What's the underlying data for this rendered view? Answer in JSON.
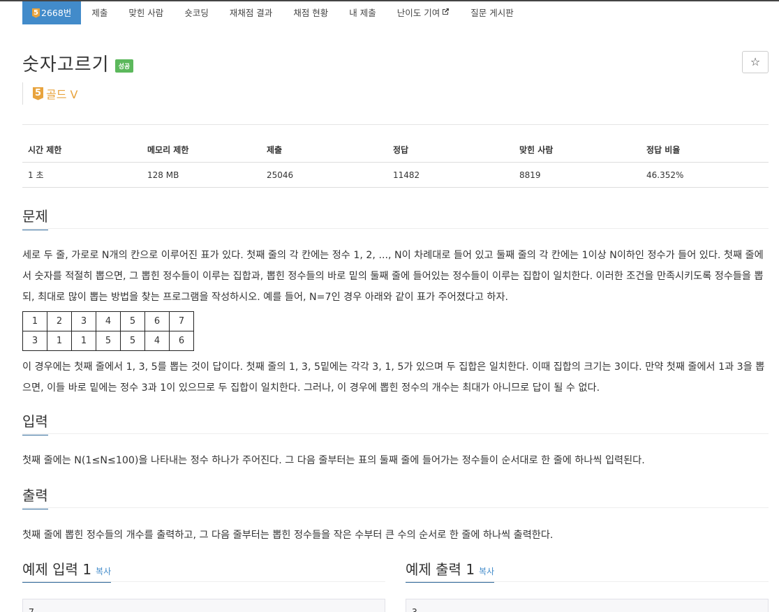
{
  "tabs": [
    {
      "label": "2668번",
      "tier": "5"
    },
    {
      "label": "제출"
    },
    {
      "label": "맞힌 사람"
    },
    {
      "label": "숏코딩"
    },
    {
      "label": "재채점 결과"
    },
    {
      "label": "채점 현황"
    },
    {
      "label": "내 제출"
    },
    {
      "label": "난이도 기여"
    },
    {
      "label": "질문 게시판"
    }
  ],
  "problem": {
    "title": "숫자고르기",
    "status_badge": "성공",
    "tier_num": "5",
    "tier_label": "골드 V",
    "star": "☆"
  },
  "info": {
    "headers": [
      "시간 제한",
      "메모리 제한",
      "제출",
      "정답",
      "맞힌 사람",
      "정답 비율"
    ],
    "values": [
      "1 초",
      "128 MB",
      "25046",
      "11482",
      "8819",
      "46.352%"
    ]
  },
  "sections": {
    "problem_head": "문제",
    "problem_p1": "세로 두 줄, 가로로 N개의 칸으로 이루어진 표가 있다. 첫째 줄의 각 칸에는 정수 1, 2, ..., N이 차례대로 들어 있고 둘째 줄의 각 칸에는 1이상 N이하인 정수가 들어 있다. 첫째 줄에서 숫자를 적절히 뽑으면, 그 뽑힌 정수들이 이루는 집합과, 뽑힌 정수들의 바로 밑의 둘째 줄에 들어있는 정수들이 이루는 집합이 일치한다. 이러한 조건을 만족시키도록 정수들을 뽑되, 최대로 많이 뽑는 방법을 찾는 프로그램을 작성하시오. 예를 들어, N=7인 경우 아래와 같이 표가 주어졌다고 하자.",
    "example_table": [
      [
        "1",
        "2",
        "3",
        "4",
        "5",
        "6",
        "7"
      ],
      [
        "3",
        "1",
        "1",
        "5",
        "5",
        "4",
        "6"
      ]
    ],
    "problem_p2": "이 경우에는 첫째 줄에서 1, 3, 5를 뽑는 것이 답이다. 첫째 줄의 1, 3, 5밑에는 각각 3, 1, 5가 있으며 두 집합은 일치한다. 이때 집합의 크기는 3이다. 만약 첫째 줄에서 1과 3을 뽑으면, 이들 바로 밑에는 정수 3과 1이 있으므로 두 집합이 일치한다. 그러나, 이 경우에 뽑힌 정수의 개수는 최대가 아니므로 답이 될 수 없다.",
    "input_head": "입력",
    "input_p": "첫째 줄에는 N(1≤N≤100)을 나타내는 정수 하나가 주어진다. 그 다음 줄부터는 표의 둘째 줄에 들어가는 정수들이 순서대로 한 줄에 하나씩 입력된다.",
    "output_head": "출력",
    "output_p": "첫째 줄에 뽑힌 정수들의 개수를 출력하고, 그 다음 줄부터는 뽑힌 정수들을 작은 수부터 큰 수의 순서로 한 줄에 하나씩 출력한다.",
    "sample_in_head": "예제 입력 1",
    "sample_out_head": "예제 출력 1",
    "copy_label": "복사",
    "sample_in_first": "7",
    "sample_out_first": "3"
  }
}
